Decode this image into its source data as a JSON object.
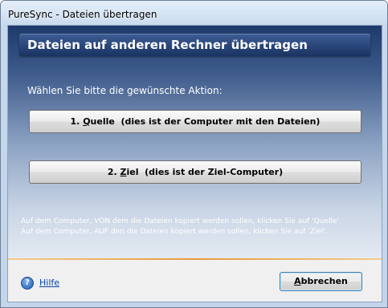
{
  "window": {
    "title": "PureSync - Dateien übertragen"
  },
  "header": {
    "title": "Dateien auf anderen Rechner übertragen"
  },
  "prompt": "Wählen Sie bitte die gewünschte Aktion:",
  "actions": [
    {
      "number": "1. ",
      "mnemonic": "Q",
      "name_rest": "uelle",
      "description": "  (dies ist der Computer mit den Dateien)"
    },
    {
      "number": "2. ",
      "mnemonic": "Z",
      "name_rest": "iel",
      "description": "  (dies ist der Ziel-Computer)"
    }
  ],
  "info": [
    "Auf dem Computer, VON dem die Dateien kopiert werden sollen, klicken Sie auf 'Quelle'.",
    "Auf dem Computer, AUF den die Dateien kopiert werden sollen, klicken Sie auf 'Ziel'."
  ],
  "footer": {
    "help_icon_glyph": "?",
    "help_label": "Hilfe",
    "cancel_mnemonic": "A",
    "cancel_rest": "bbrechen"
  },
  "colors": {
    "header_banner": "#1a3361",
    "panel_top": "#1d3a6b",
    "separator": "#e89a3a",
    "link": "#0645ad"
  }
}
